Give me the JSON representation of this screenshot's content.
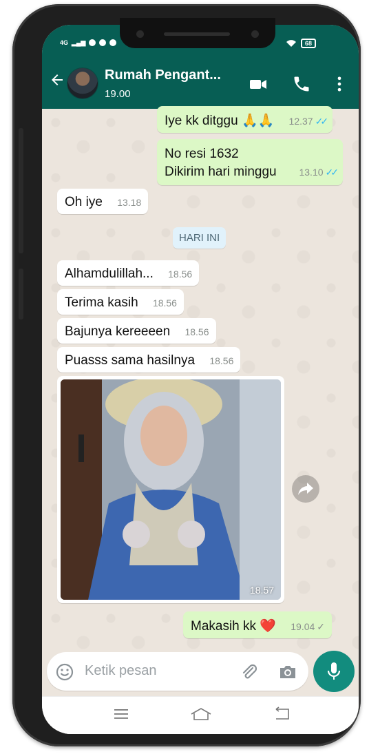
{
  "status_bar": {
    "network": "4G",
    "signal": "ıll",
    "battery": "68"
  },
  "header": {
    "contact_name": "Rumah Pengant...",
    "subtitle": "19.00"
  },
  "messages": [
    {
      "dir": "out",
      "text": "Iye kk ditggu 🙏🙏",
      "time": "12.37",
      "status": "read"
    },
    {
      "dir": "out",
      "lines": [
        "No resi 1632",
        "Dikirim hari minggu"
      ],
      "time": "13.10",
      "status": "read"
    },
    {
      "dir": "in",
      "text": "Oh iye",
      "time": "13.18"
    },
    {
      "dir": "in",
      "text": "Alhamdulillah...",
      "time": "18.56"
    },
    {
      "dir": "in",
      "text": "Terima kasih",
      "time": "18.56"
    },
    {
      "dir": "in",
      "text": "Bajunya kereeeen",
      "time": "18.56"
    },
    {
      "dir": "in",
      "text": "Puasss sama hasilnya",
      "time": "18.56"
    },
    {
      "dir": "in",
      "type": "image",
      "time": "18.57"
    },
    {
      "dir": "out",
      "text": "Makasih kk ❤️",
      "time": "19.04",
      "status": "sent"
    }
  ],
  "date_divider": "HARI INI",
  "composer": {
    "placeholder": "Ketik pesan"
  },
  "icons": {
    "back": "arrow-left-icon",
    "video": "video-call-icon",
    "call": "phone-icon",
    "menu": "more-vert-icon",
    "emoji": "emoji-icon",
    "attach": "paperclip-icon",
    "camera": "camera-icon",
    "mic": "mic-icon",
    "share": "forward-icon",
    "read": "double-check-icon",
    "sent": "check-icon"
  },
  "colors": {
    "header": "#075e54",
    "outgoing_bubble": "#dcf8c6",
    "incoming_bubble": "#ffffff",
    "read_ticks": "#34b7f1",
    "mic_button": "#128c7e",
    "chat_bg": "#ece5dd"
  }
}
